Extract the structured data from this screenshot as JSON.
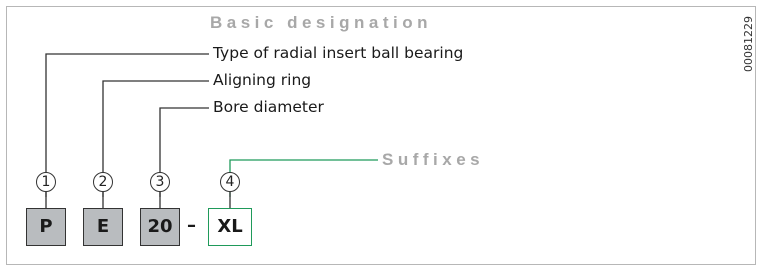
{
  "heading_basic": "Basic designation",
  "heading_suffixes": "Suffixes",
  "labels": {
    "type": "Type of radial insert ball bearing",
    "aligning": "Aligning ring",
    "bore": "Bore diameter"
  },
  "markers": [
    "1",
    "2",
    "3",
    "4"
  ],
  "boxes": [
    "P",
    "E",
    "20",
    "XL"
  ],
  "separator": "–",
  "figure_code": "00081229",
  "colors": {
    "basic_box_fill": "#b9bcbf",
    "suffix_line": "#1f9a5a",
    "leader_line": "#333333",
    "heading_text": "#a8a8a8"
  }
}
